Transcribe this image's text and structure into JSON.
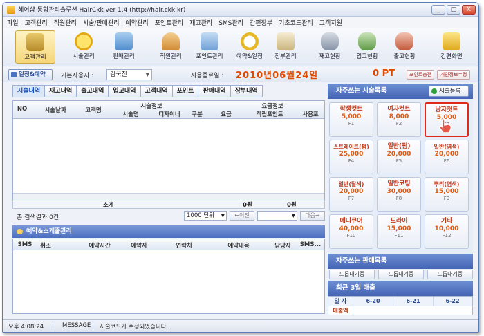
{
  "window": {
    "title": "헤어샵 통합관리솔루션 HairCkk ver 1.4 (http://hair.ckk.kr)",
    "buttons": [
      "_",
      "□",
      "X"
    ]
  },
  "menu": [
    "파일",
    "고객관리",
    "직원관리",
    "시술/판매관리",
    "예약관리",
    "포인트관리",
    "재고관리",
    "SMS관리",
    "간편장부",
    "기초코드관리",
    "고객지원"
  ],
  "toolbar": [
    {
      "label": "고객관리",
      "icon": "customer-icon",
      "color": "#c9a23d"
    },
    {
      "label": "시술관리",
      "icon": "smiley-icon",
      "color": "#f2c21b"
    },
    {
      "label": "판매관리",
      "icon": "sale-icon",
      "color": "#6ea7dc"
    },
    {
      "label": "직원관리",
      "icon": "staff-icon",
      "color": "#e3a955"
    },
    {
      "label": "포인트관리",
      "icon": "point-icon",
      "color": "#7fb3e2"
    },
    {
      "label": "예약&일정",
      "icon": "clock-icon",
      "color": "#e9c43c"
    },
    {
      "label": "장부관리",
      "icon": "notebook-icon",
      "color": "#d6c7a0"
    },
    {
      "label": "재고현황",
      "icon": "stock-icon",
      "color": "#9aa7b8"
    },
    {
      "label": "입고현황",
      "icon": "stock-in-icon",
      "color": "#83b06b"
    },
    {
      "label": "출고현황",
      "icon": "stock-out-icon",
      "color": "#d98a6e"
    },
    {
      "label": "간편화면",
      "icon": "simple-view-icon",
      "color": "#efcb3b"
    }
  ],
  "infobar": {
    "schedule_btn": "일정&예약",
    "user_label": "기본사용자 :",
    "user_value": "김국진",
    "expire_label": "사용종료일 :",
    "expire_date": "2010년06월24일",
    "points": "0 PT",
    "charge_btn": "포인트충전",
    "personal_btn": "개인정보수정"
  },
  "tabs": [
    "시술내역",
    "재고내역",
    "출고내역",
    "입고내역",
    "고객내역",
    "포인트",
    "판매내역",
    "장부내역"
  ],
  "grid": {
    "group_headers": [
      "시술정보",
      "요금정보"
    ],
    "columns": [
      "NO",
      "시술날짜",
      "고객명",
      "시술명",
      "디자이너",
      "구분",
      "요금",
      "적립포인트",
      "사용포"
    ],
    "total_label": "소계",
    "total_values": [
      "0원",
      "0원"
    ]
  },
  "pager": {
    "count_text": "총 검색결과 0건",
    "unit": "1000 단위",
    "prev": "←이전",
    "next": "다음→"
  },
  "schedule": {
    "title": "예약&스케줄관리",
    "columns": [
      "SMS",
      "취소",
      "예약시간",
      "예약자",
      "연락처",
      "예약내용",
      "담당자",
      "SMS..."
    ]
  },
  "right_panel": {
    "favorites_title": "자주쓰는 시술목록",
    "register_btn": "시술등록",
    "services": [
      {
        "name": "학생컷트",
        "price": "5,000",
        "key": "F1"
      },
      {
        "name": "여자컷트",
        "price": "8,000",
        "key": "F2"
      },
      {
        "name": "남자컷트",
        "price": "5,000",
        "key": "F3"
      },
      {
        "name": "스트레이트(펌)",
        "price": "25,000",
        "key": "F4"
      },
      {
        "name": "일반(펌)",
        "price": "20,000",
        "key": "F5"
      },
      {
        "name": "일반(염색)",
        "price": "20,000",
        "key": "F6"
      },
      {
        "name": "일반(탈색)",
        "price": "20,000",
        "key": "F7"
      },
      {
        "name": "일반코팅",
        "price": "30,000",
        "key": "F8"
      },
      {
        "name": "뿌리(염색)",
        "price": "15,000",
        "key": "F9"
      },
      {
        "name": "메니큐어",
        "price": "40,000",
        "key": "F10"
      },
      {
        "name": "드라이",
        "price": "15,000",
        "key": "F11"
      },
      {
        "name": "기타",
        "price": "10,000",
        "key": "F12"
      }
    ],
    "products_title": "자주쓰는 판매목록",
    "products": [
      "드롭대기중",
      "드롭대기중",
      "드롭대기중"
    ],
    "sales_title": "최근 3일 매출",
    "sales_header": [
      "일 자",
      "6-20",
      "6-21",
      "6-22"
    ],
    "sales_row_label": "매출액"
  },
  "statusbar": {
    "time": "오후 4:08:24",
    "type": "MESSAGE",
    "message": "시술코드가 수정되었습니다."
  }
}
